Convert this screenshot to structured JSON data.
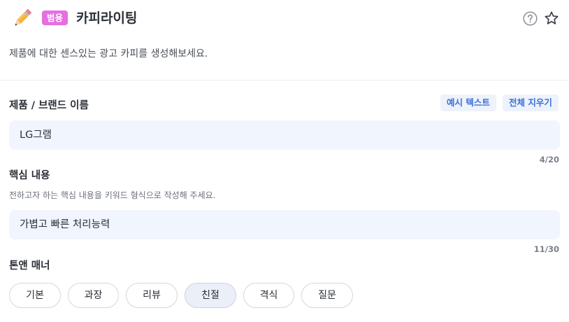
{
  "header": {
    "category_badge": "범용",
    "title": "카피라이팅",
    "icons": [
      "pencil-icon",
      "help-icon",
      "star-icon"
    ]
  },
  "description": "제품에 대한 센스있는 광고 카피를 생성해보세요.",
  "product": {
    "label": "제품 / 브랜드 이름",
    "example_button": "예시 텍스트",
    "clear_button": "전체 지우기",
    "value": "LG그램",
    "counter": "4/20"
  },
  "core": {
    "label": "핵심 내용",
    "hint": "전하고자 하는 핵심 내용을 키워드 형식으로 작성해 주세요.",
    "value": "가볍고 빠른 처리능력",
    "counter": "11/30"
  },
  "tone": {
    "label": "톤앤 매너",
    "options": [
      "기본",
      "과장",
      "리뷰",
      "친절",
      "격식",
      "질문"
    ],
    "selected": "친절"
  },
  "colors": {
    "badge": "#e56ee0",
    "accent_text": "#3a6fd8",
    "field_bg": "#f1f5fd"
  }
}
